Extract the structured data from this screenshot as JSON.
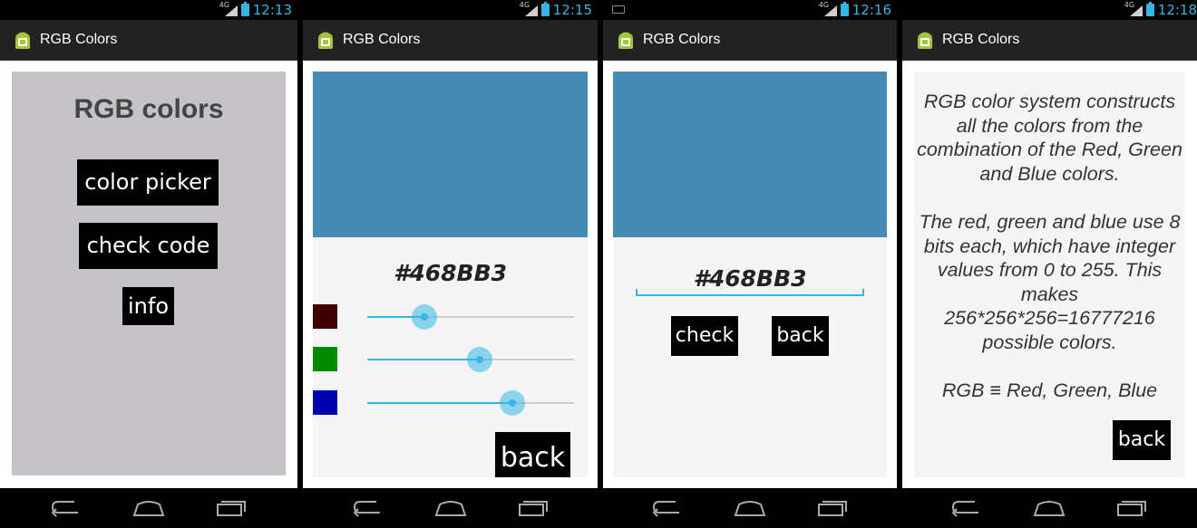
{
  "app": {
    "title": "RGB Colors"
  },
  "screens": [
    {
      "time": "12:13",
      "menu": {
        "title": "RGB colors",
        "buttons": [
          "color picker",
          "check code",
          "info"
        ]
      }
    },
    {
      "time": "12:15",
      "color_picker": {
        "hex": "#468BB3",
        "preview_color": "#468bb3",
        "sliders": [
          {
            "channel": "red",
            "value": 70,
            "swatch_color": "#3e0000"
          },
          {
            "channel": "green",
            "value": 139,
            "swatch_color": "#008b00"
          },
          {
            "channel": "blue",
            "value": 179,
            "swatch_color": "#0000b3"
          }
        ],
        "max": 255,
        "back_label": "back"
      }
    },
    {
      "time": "12:16",
      "check_code": {
        "input_value": "#468BB3",
        "preview_color": "#468bb3",
        "check_label": "check",
        "back_label": "back"
      }
    },
    {
      "time": "12:18",
      "info": {
        "paragraph1": "RGB color system constructs all the colors from the combination of the Red, Green and Blue colors.",
        "paragraph2": "The red, green and blue use 8 bits each, which have integer values from 0 to 255. This makes 256*256*256=16777216 possible colors.",
        "paragraph3": "RGB  ≡  Red, Green, Blue",
        "back_label": "back"
      }
    }
  ],
  "colors": {
    "accent": "#33b5e5",
    "action_bar": "#222222",
    "menu_bg": "#c5c3c8"
  },
  "icons": {
    "app": "android-icon",
    "nav": [
      "back-icon",
      "home-icon",
      "recents-icon"
    ],
    "status": [
      "signal-4g-icon",
      "battery-charging-icon"
    ]
  }
}
